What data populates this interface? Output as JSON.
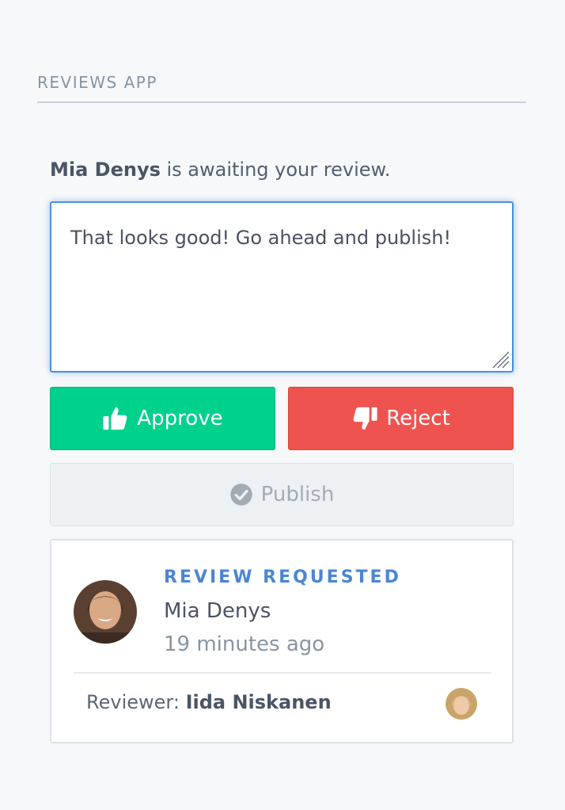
{
  "app": {
    "title": "REVIEWS APP"
  },
  "review": {
    "requester_name": "Mia Denys",
    "prompt_suffix": " is awaiting your review.",
    "comment_text": "That looks good! Go ahead and publish!"
  },
  "actions": {
    "approve_label": "Approve",
    "reject_label": "Reject",
    "publish_label": "Publish"
  },
  "card": {
    "status": "REVIEW REQUESTED",
    "name": "Mia Denys",
    "time": "19 minutes ago",
    "reviewer_prefix": "Reviewer: ",
    "reviewer_name": "Iida Niskanen"
  },
  "colors": {
    "approve": "#00d18c",
    "reject": "#ef5350",
    "accent": "#4a86d4"
  },
  "icons": {
    "approve": "thumbs-up-icon",
    "reject": "thumbs-down-icon",
    "publish": "check-circle-icon"
  }
}
